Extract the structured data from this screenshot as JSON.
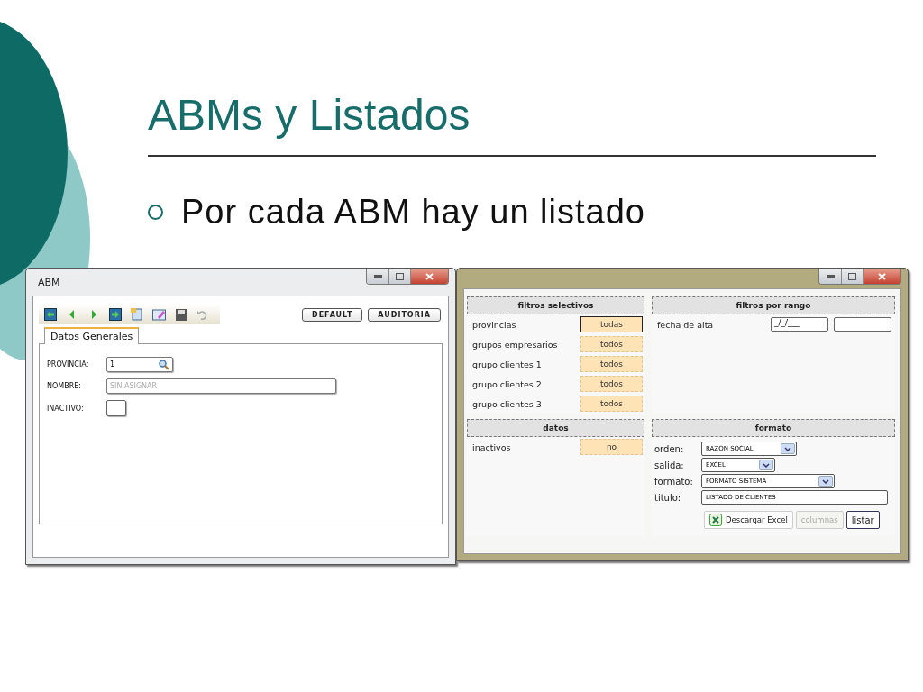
{
  "slide": {
    "title": "ABMs y Listados",
    "bullets": [
      "Por cada ABM hay un listado"
    ]
  },
  "abm_window": {
    "title": "ABM",
    "toolbar_buttons": [
      "DEFAULT",
      "AUDITORIA"
    ],
    "tabs": [
      {
        "label": "Datos Generales",
        "selected": true
      }
    ],
    "fields": [
      {
        "kind": "lookup",
        "label": "PROVINCIA:",
        "value": "1"
      },
      {
        "kind": "text",
        "label": "NOMBRE:",
        "placeholder": "SIN ASIGNAR"
      },
      {
        "kind": "checkbox",
        "label": "INACTIVO:",
        "checked": false
      }
    ]
  },
  "listado_window": {
    "selective_filters": {
      "heading": "filtros selectivos",
      "rows": [
        {
          "label": "provincias",
          "value": "todas",
          "selected": true
        },
        {
          "label": "grupos empresarios",
          "value": "todos",
          "selected": false
        },
        {
          "label": "grupo clientes 1",
          "value": "todos",
          "selected": false
        },
        {
          "label": "grupo clientes 2",
          "value": "todos",
          "selected": false
        },
        {
          "label": "grupo clientes 3",
          "value": "todos",
          "selected": false
        }
      ]
    },
    "range_filters": {
      "heading": "filtros por rango",
      "rows": [
        {
          "label": "fecha de alta",
          "from": "_/_/___",
          "to": ""
        }
      ]
    },
    "data": {
      "heading": "datos",
      "rows": [
        {
          "label": "inactivos",
          "value": "no",
          "selected": false
        }
      ]
    },
    "format": {
      "heading": "formato",
      "fields": [
        {
          "kind": "select",
          "label": "orden:",
          "value": "RAZON SOCIAL"
        },
        {
          "kind": "select",
          "label": "salida:",
          "value": "EXCEL"
        },
        {
          "kind": "select",
          "label": "formato:",
          "value": "FORMATO SISTEMA"
        },
        {
          "kind": "text",
          "label": "titulo:",
          "value": "LISTADO DE CLIENTES"
        }
      ],
      "buttons": [
        {
          "label": "Descargar Excel",
          "disabled": false,
          "kind": "excel"
        },
        {
          "label": "columnas",
          "disabled": true,
          "kind": "plain"
        },
        {
          "label": "listar",
          "disabled": false,
          "kind": "primary"
        }
      ]
    }
  }
}
